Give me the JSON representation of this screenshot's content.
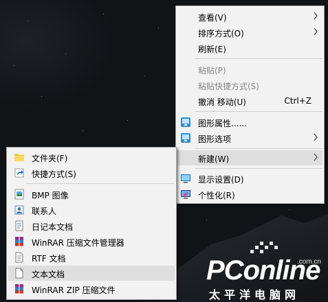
{
  "context_menu": {
    "items": [
      {
        "label": "查看(V)",
        "submenu": true
      },
      {
        "label": "排序方式(O)",
        "submenu": true
      },
      {
        "label": "刷新(E)"
      },
      {
        "label": "粘贴(P)",
        "disabled": true
      },
      {
        "label": "粘贴快捷方式(S)",
        "disabled": true
      },
      {
        "label": "撤消 移动(U)",
        "shortcut": "Ctrl+Z"
      },
      {
        "label": "图形属性......",
        "icon": "graphics-properties-icon"
      },
      {
        "label": "图形选项",
        "icon": "graphics-options-icon",
        "submenu": true
      },
      {
        "label": "新建(W)",
        "submenu": true,
        "highlighted": true
      },
      {
        "label": "显示设置(D)",
        "icon": "display-settings-icon"
      },
      {
        "label": "个性化(R)",
        "icon": "personalize-icon"
      }
    ]
  },
  "new_submenu": {
    "items": [
      {
        "label": "文件夹(F)",
        "icon": "folder-icon"
      },
      {
        "label": "快捷方式(S)",
        "icon": "shortcut-icon"
      },
      {
        "label": "BMP 图像",
        "icon": "bmp-image-icon"
      },
      {
        "label": "联系人",
        "icon": "contact-icon"
      },
      {
        "label": "日记本文档",
        "icon": "journal-icon"
      },
      {
        "label": "WinRAR 压缩文件管理器",
        "icon": "winrar-icon"
      },
      {
        "label": "RTF 文档",
        "icon": "rtf-document-icon"
      },
      {
        "label": "文本文档",
        "icon": "text-document-icon",
        "highlighted": true
      },
      {
        "label": "WinRAR ZIP 压缩文件",
        "icon": "winrar-zip-icon"
      }
    ]
  },
  "watermark": {
    "logo": "PConline",
    "domain": ".com.cn",
    "chinese": "太平洋电脑网"
  }
}
